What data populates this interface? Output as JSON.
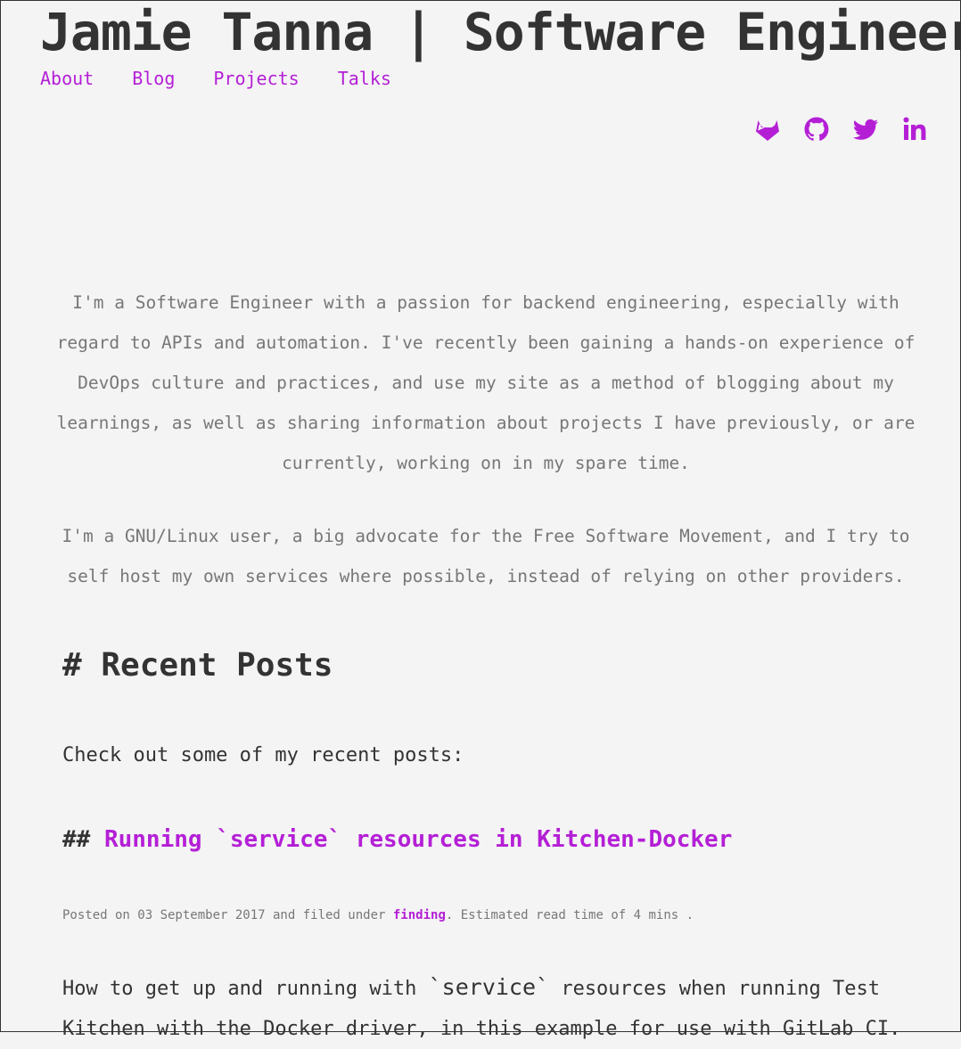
{
  "header": {
    "title": "Jamie Tanna | Software Engineer",
    "nav": [
      "About",
      "Blog",
      "Projects",
      "Talks"
    ]
  },
  "social": [
    {
      "name": "gitlab-icon"
    },
    {
      "name": "github-icon"
    },
    {
      "name": "twitter-icon"
    },
    {
      "name": "linkedin-icon"
    }
  ],
  "intro": {
    "p1": "I'm a Software Engineer with a passion for backend engineering, especially with regard to APIs and automation. I've recently been gaining a hands-on experience of DevOps culture and practices, and use my site as a method of blogging about my learnings, as well as sharing information about projects I have previously, or are currently, working on in my spare time.",
    "p2": "I'm a GNU/Linux user, a big advocate for the Free Software Movement, and I try to self host my own services where possible, instead of relying on other providers."
  },
  "recent": {
    "hash": "#",
    "heading": "Recent Posts",
    "check": "Check out some of my recent posts:"
  },
  "post": {
    "hash": "##",
    "title": "Running `service` resources in Kitchen-Docker",
    "meta_prefix": "Posted on 03 September 2017 and filed under ",
    "category": "finding",
    "meta_suffix": ". Estimated read time of 4 mins .",
    "summary_start": "How to get up and running with ",
    "summary_code": "`service`",
    "summary_end": " resources when running Test Kitchen with the Docker driver, in this example for use with GitLab CI."
  },
  "colors": {
    "accent": "#b41fd6",
    "text": "#333333",
    "muted": "#777777",
    "background": "#f4f4f4"
  }
}
